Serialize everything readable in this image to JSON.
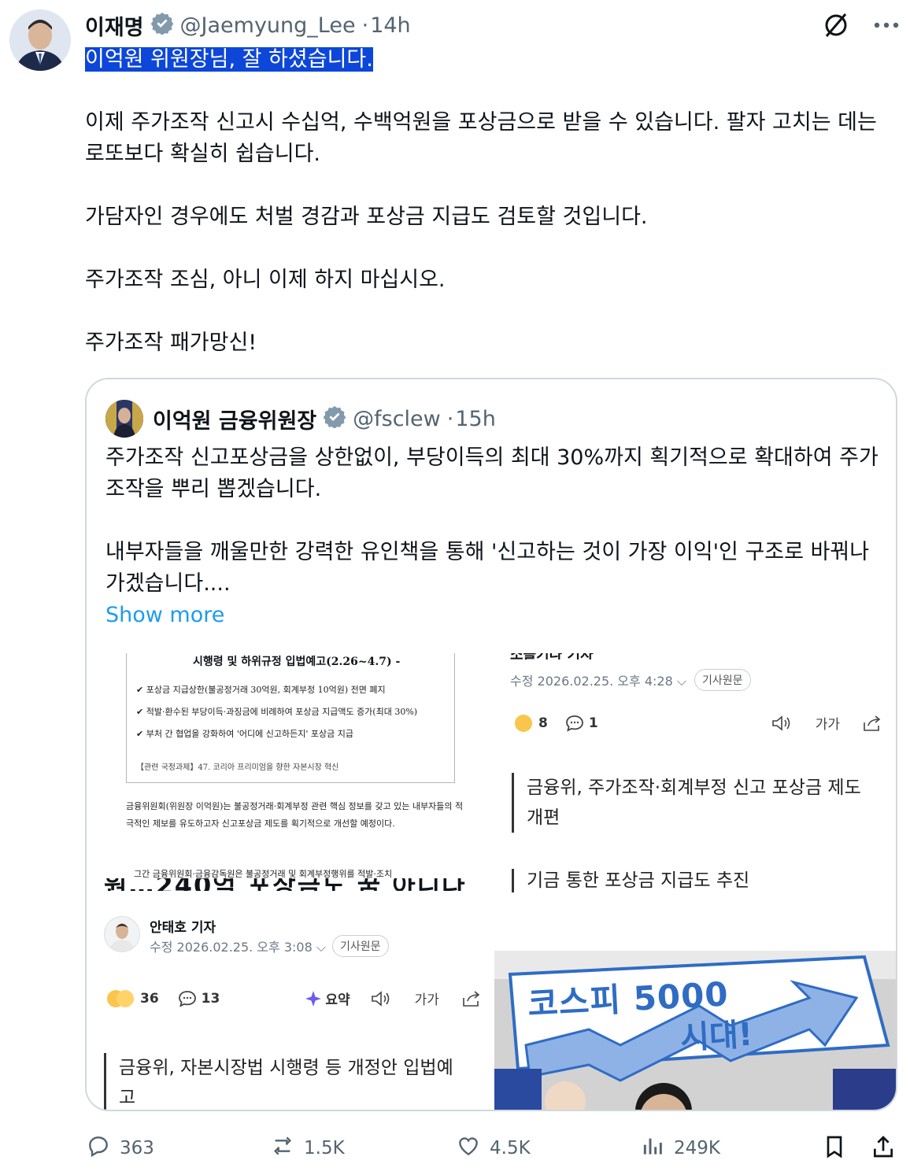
{
  "author": {
    "name": "이재명",
    "handle": "@Jaemyung_Lee",
    "time": "14h"
  },
  "tweet": {
    "highlight": "이억원 위원장님, 잘 하셨습니다.",
    "para1": "이제 주가조작 신고시 수십억, 수백억원을 포상금으로 받을 수 있습니다. 팔자 고치는 데는 로또보다 확실히 쉽습니다.",
    "para2": "가담자인 경우에도 처벌 경감과 포상금 지급도 검토할 것입니다.",
    "para3": "주가조작 조심, 아니 이제 하지 마십시오.",
    "para4": "주가조작 패가망신!"
  },
  "quote": {
    "name": "이억원 금융위원장",
    "handle": "@fsclew",
    "time": "15h",
    "para1": "주가조작 신고포상금을 상한없이, 부당이득의 최대 30%까지 획기적으로 확대하여 주가조작을 뿌리 뽑겠습니다.",
    "para2": "내부자들을 깨울만한 강력한 유인책을 통해 '신고하는 것이 가장 이익'인 구조로 바꿔나가겠습니다....",
    "show_more": "Show more"
  },
  "image_left": {
    "doc_title": "시행령 및 하위규정 입법예고(2.26~4.7) -",
    "doc_lines": [
      "✔ 포상금 지급상한(불공정거래 30억원, 회계부정 10억원) 전면 폐지",
      "✔ 적발·환수된 부당이득·과징금에 비례하여 포상금 지급액도 증가(최대 30%)",
      "✔ 부처 간 협업을 강화하여 '어디에 신고하든지' 포상금 지급"
    ],
    "doc_footer": "【관련 국정과제】47. 코리아 프리미엄을 향한 자본시장 혁신",
    "doc_para": "금융위원회(위원장 이억원)는 불공정거래·회계부정 관련 핵심 정보를 갖고 있는 내부자들의 적극적인 제보를 유도하고자 신고포상금 제도를 획기적으로 개선할 예정이다.",
    "doc_cut": "그간 금융위원회·금융감독원은 불공정거래 및 회계부정행위를 적발·조치",
    "big_cut": "원…240억 포상금도 꿈 아니다",
    "reporter": "안태호 기자",
    "date": "수정 2026.02.25. 오후 3:08",
    "original_label": "기사원문",
    "reactions": "36",
    "comments": "13",
    "summary": "요약",
    "font_size": "가가",
    "headline": "금융위, 자본시장법 시행령 등 개정안 입법예고"
  },
  "image_right": {
    "top_cut": "소블기나 기사",
    "date": "수정 2026.02.25. 오후 4:28",
    "original_label": "기사원문",
    "reactions": "8",
    "comments": "1",
    "font_size": "가가",
    "headline": "금융위, 주가조작·회계부정 신고 포상금 제도 개편",
    "subhead": "기금 통한 포상금 지급도 추진",
    "photo_text1": "코스피 5000",
    "photo_text2": "시대!"
  },
  "actions": {
    "replies": "363",
    "reposts": "1.5K",
    "likes": "4.5K",
    "views": "249K"
  },
  "colors": {
    "highlight_bg": "#0d47d9",
    "link": "#1d9bf0",
    "muted": "#536471",
    "border": "#cfd9de"
  }
}
